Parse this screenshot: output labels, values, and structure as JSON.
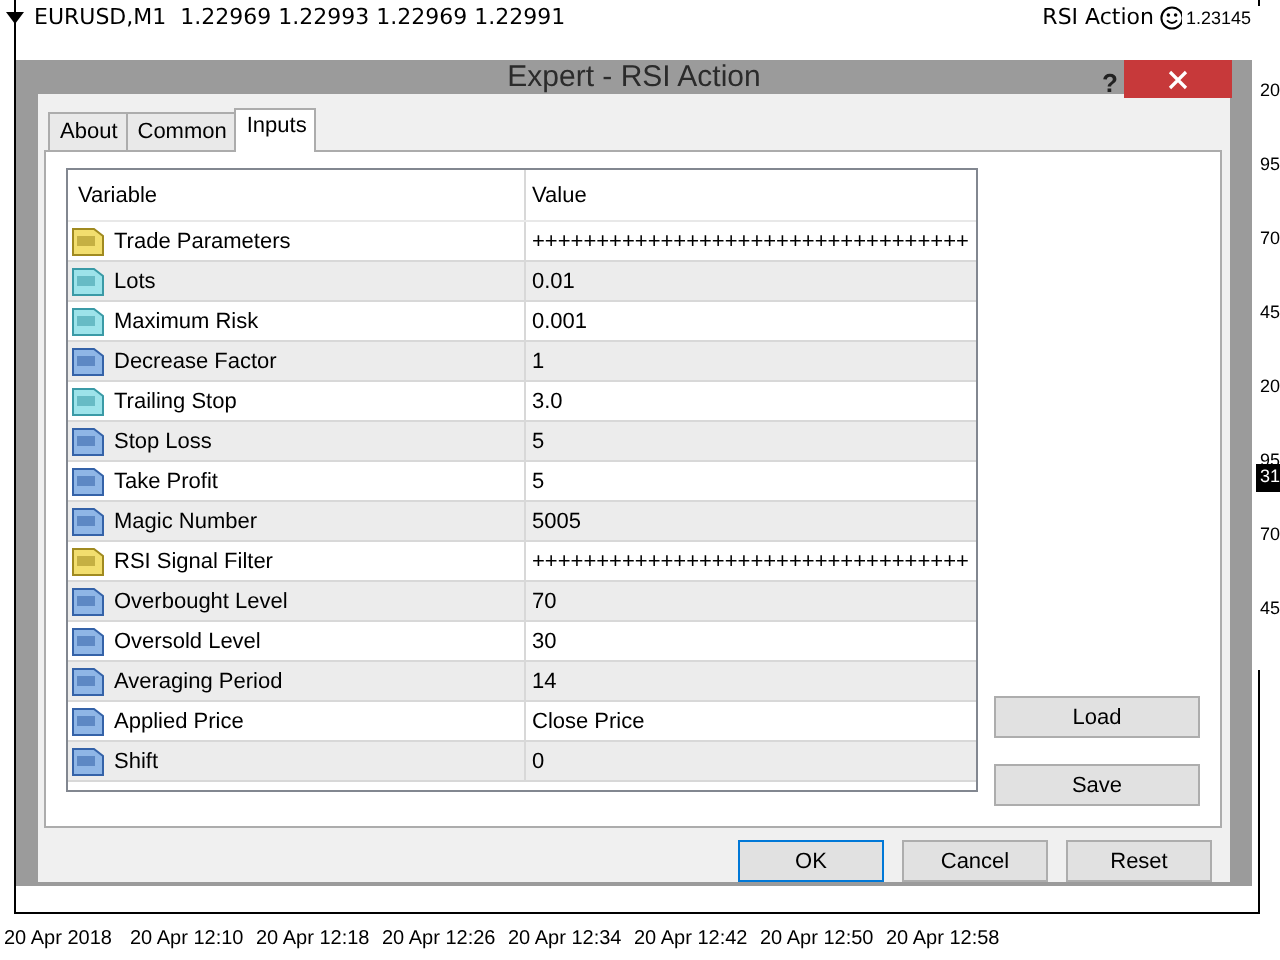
{
  "chart": {
    "symbol_line": "EURUSD,M1  1.22969 1.22993 1.22969 1.22991",
    "expert_label": "RSI Action",
    "price_labels": [
      {
        "text": "1.23145",
        "current": false
      },
      {
        "text": "20",
        "current": false
      },
      {
        "text": "95",
        "current": false
      },
      {
        "text": "70",
        "current": false
      },
      {
        "text": "45",
        "current": false
      },
      {
        "text": "20",
        "current": false
      },
      {
        "text": "95",
        "current": false
      },
      {
        "text": "31",
        "current": true
      },
      {
        "text": "70",
        "current": false
      },
      {
        "text": "45",
        "current": false
      }
    ],
    "time_labels": [
      "20 Apr 2018",
      "20 Apr 12:10",
      "20 Apr 12:18",
      "20 Apr 12:26",
      "20 Apr 12:34",
      "20 Apr 12:42",
      "20 Apr 12:50",
      "20 Apr 12:58"
    ]
  },
  "dialog": {
    "title": "Expert - RSI Action",
    "help": "?",
    "tabs": [
      {
        "label": "About",
        "selected": false
      },
      {
        "label": "Common",
        "selected": false
      },
      {
        "label": "Inputs",
        "selected": true
      }
    ],
    "table": {
      "columns": [
        "Variable",
        "Value"
      ],
      "rows": [
        {
          "kind": "string",
          "variable": "Trade Parameters",
          "value": "++++++++++++++++++++++++++++++++++"
        },
        {
          "kind": "double",
          "variable": "Lots",
          "value": "0.01"
        },
        {
          "kind": "double",
          "variable": "Maximum Risk",
          "value": "0.001"
        },
        {
          "kind": "integer",
          "variable": "Decrease Factor",
          "value": "1"
        },
        {
          "kind": "double",
          "variable": "Trailing Stop",
          "value": "3.0"
        },
        {
          "kind": "integer",
          "variable": "Stop Loss",
          "value": "5"
        },
        {
          "kind": "integer",
          "variable": "Take Profit",
          "value": "5"
        },
        {
          "kind": "integer",
          "variable": "Magic Number",
          "value": "5005"
        },
        {
          "kind": "string",
          "variable": "RSI Signal Filter",
          "value": "++++++++++++++++++++++++++++++++++"
        },
        {
          "kind": "integer",
          "variable": "Overbought Level",
          "value": "70"
        },
        {
          "kind": "integer",
          "variable": "Oversold Level",
          "value": "30"
        },
        {
          "kind": "integer",
          "variable": "Averaging Period",
          "value": "14"
        },
        {
          "kind": "integer",
          "variable": "Applied Price",
          "value": "Close Price"
        },
        {
          "kind": "integer",
          "variable": "Shift",
          "value": "0"
        }
      ]
    },
    "side_buttons": [
      "Load",
      "Save"
    ],
    "buttons": [
      {
        "label": "OK",
        "default": true
      },
      {
        "label": "Cancel",
        "default": false
      },
      {
        "label": "Reset",
        "default": false
      }
    ]
  }
}
